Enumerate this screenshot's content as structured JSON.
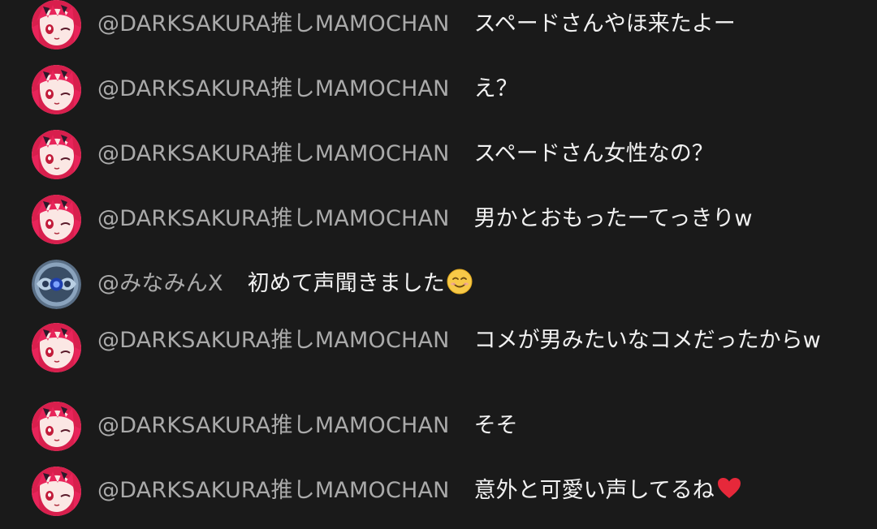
{
  "messages": [
    {
      "author": "@DARKSAKURA推しMAMOCHAN",
      "avatar": "anime-girl-avatar",
      "text": "スペードさんやほ来たよー"
    },
    {
      "author": "@DARKSAKURA推しMAMOCHAN",
      "avatar": "anime-girl-avatar",
      "text": "え？"
    },
    {
      "author": "@DARKSAKURA推しMAMOCHAN",
      "avatar": "anime-girl-avatar",
      "text": "スペードさん女性なの？"
    },
    {
      "author": "@DARKSAKURA推しMAMOCHAN",
      "avatar": "anime-girl-avatar",
      "text": "男かとおもったーてっきりw"
    },
    {
      "author": "@みなみんX",
      "avatar": "blue-emblem-avatar",
      "text": "初めて声聞きました",
      "emoji": "smiling-face-emoji"
    },
    {
      "author": "@DARKSAKURA推しMAMOCHAN",
      "avatar": "anime-girl-avatar",
      "text": "コメが男みたいなコメだったからw"
    },
    {
      "author": "@DARKSAKURA推しMAMOCHAN",
      "avatar": "anime-girl-avatar",
      "text": "そそ"
    },
    {
      "author": "@DARKSAKURA推しMAMOCHAN",
      "avatar": "anime-girl-avatar",
      "text": "意外と可愛い声してるね",
      "emoji": "red-heart-emoji"
    }
  ],
  "colors": {
    "background": "#1a1a1a",
    "author_text": "#aaaaaa",
    "message_text": "#f1f1f1",
    "avatar_accent": "#e8245a"
  }
}
